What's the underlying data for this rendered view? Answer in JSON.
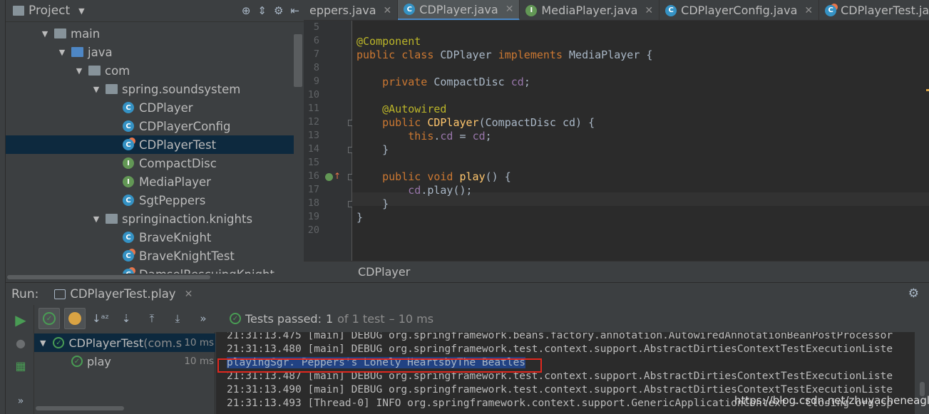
{
  "project_panel": {
    "title": "Project",
    "tree": [
      {
        "label": "main",
        "type": "folder",
        "depth": 1,
        "expanded": true
      },
      {
        "label": "java",
        "type": "folder-blue",
        "depth": 2,
        "expanded": true
      },
      {
        "label": "com",
        "type": "package",
        "depth": 3,
        "expanded": true
      },
      {
        "label": "spring.soundsystem",
        "type": "package",
        "depth": 4,
        "expanded": true
      },
      {
        "label": "CDPlayer",
        "type": "class",
        "depth": 5
      },
      {
        "label": "CDPlayerConfig",
        "type": "class",
        "depth": 5
      },
      {
        "label": "CDPlayerTest",
        "type": "test",
        "depth": 5,
        "selected": true
      },
      {
        "label": "CompactDisc",
        "type": "interface",
        "depth": 5
      },
      {
        "label": "MediaPlayer",
        "type": "interface",
        "depth": 5
      },
      {
        "label": "SgtPeppers",
        "type": "class",
        "depth": 5
      },
      {
        "label": "springinaction.knights",
        "type": "package",
        "depth": 4,
        "expanded": true
      },
      {
        "label": "BraveKnight",
        "type": "class",
        "depth": 5
      },
      {
        "label": "BraveKnightTest",
        "type": "test",
        "depth": 5
      },
      {
        "label": "DamselRescuingKnight",
        "type": "test",
        "depth": 5
      }
    ]
  },
  "editor": {
    "tabs": [
      {
        "label": "eppers.java",
        "icon": "class-icon",
        "active": false
      },
      {
        "label": "CDPlayer.java",
        "icon": "class-icon",
        "active": true
      },
      {
        "label": "MediaPlayer.java",
        "icon": "interface-icon",
        "active": false
      },
      {
        "label": "CDPlayerConfig.java",
        "icon": "class-icon",
        "active": false
      },
      {
        "label": "CDPlayerTest.java",
        "icon": "test-class-icon",
        "active": false
      }
    ],
    "lines": [
      {
        "num": "5",
        "code": ""
      },
      {
        "num": "6",
        "code": "@Component"
      },
      {
        "num": "7",
        "code": "public class CDPlayer implements MediaPlayer {"
      },
      {
        "num": "8",
        "code": ""
      },
      {
        "num": "9",
        "code": "    private CompactDisc cd;"
      },
      {
        "num": "10",
        "code": ""
      },
      {
        "num": "11",
        "code": "    @Autowired"
      },
      {
        "num": "12",
        "code": "    public CDPlayer(CompactDisc cd) {"
      },
      {
        "num": "13",
        "code": "        this.cd = cd;"
      },
      {
        "num": "14",
        "code": "    }"
      },
      {
        "num": "15",
        "code": ""
      },
      {
        "num": "16",
        "code": "    public void play() {"
      },
      {
        "num": "17",
        "code": "        cd.play();"
      },
      {
        "num": "18",
        "code": "    }"
      },
      {
        "num": "19",
        "code": "}"
      },
      {
        "num": "20",
        "code": ""
      }
    ],
    "breadcrumb": "CDPlayer"
  },
  "run_panel": {
    "label": "Run:",
    "tab_label": "CDPlayerTest.play",
    "status": {
      "prefix": "Tests passed:",
      "count": "1",
      "of_total": "of 1 test",
      "duration": "– 10 ms"
    },
    "test_tree": [
      {
        "label": "CDPlayerTest",
        "sub": "(com.s",
        "time": "10 ms",
        "selected": true
      },
      {
        "label": "play",
        "sub": "",
        "time": "10 ms",
        "selected": false
      }
    ],
    "console": [
      "21:31:13.475 [main] DEBUG org.springframework.beans.factory.annotation.AutowiredAnnotationBeanPostProcessor",
      "21:31:13.480 [main] DEBUG org.springframework.test.context.support.AbstractDirtiesContextTestExecutionListe",
      "playingSgr. Peppers's Lonely HeartsbyThe Beatles",
      "21:31:13.487 [main] DEBUG org.springframework.test.context.support.AbstractDirtiesContextTestExecutionListe",
      "21:31:13.490 [main] DEBUG org.springframework.test.context.support.AbstractDirtiesContextTestExecutionListe",
      "21:31:13.493 [Thread-0] INFO org.springframework.context.support.GenericApplicationContext - Closing org.sp"
    ]
  },
  "watermark": "https://blog.csdn.net/zhuyacheneagle",
  "colors": {
    "background": "#3c3f41",
    "editor_background": "#2b2b2b",
    "keyword": "#cc7832",
    "annotation": "#bbb529",
    "field": "#9876aa",
    "method": "#ffc66d",
    "selection": "#0d293e",
    "pass_green": "#499c54",
    "highlight_box": "#e0281f"
  }
}
